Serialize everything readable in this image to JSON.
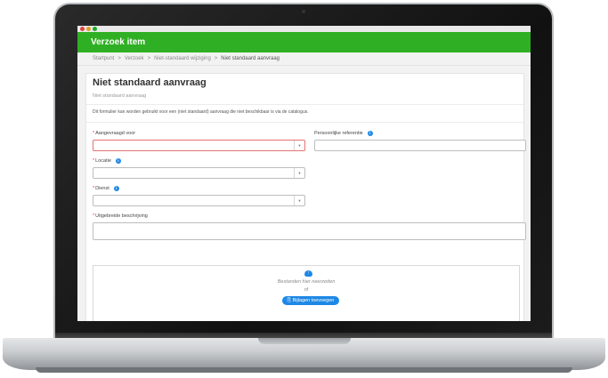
{
  "app": {
    "title": "Verzoek item"
  },
  "breadcrumb": [
    "Startpunt",
    "Verzoek",
    "Niet-standaard wijziging",
    "Niet standaard aanvraag"
  ],
  "page": {
    "title": "Niet standaard aanvraag",
    "subtitle": "Niet standaard aanvraag",
    "intro": "Dit formulier kan worden gebruikt voor een (niet standaard) aanvraag die niet beschikbaar is via de catalogus."
  },
  "form": {
    "requested_for": {
      "label": "Aangevraagd voor",
      "value": ""
    },
    "personal_reference": {
      "label": "Persoonlijke referentie",
      "value": ""
    },
    "location": {
      "label": "Locatie",
      "value": ""
    },
    "service": {
      "label": "Dienst",
      "value": ""
    },
    "description": {
      "label": "Uitgebreide beschrijving",
      "value": ""
    }
  },
  "attachments": {
    "drop_text": "Bestanden hier neerzetten",
    "or_text": "of",
    "button_label": "Bijlagen toevoegen"
  },
  "colors": {
    "header_green": "#2fb024",
    "accent_blue": "#1e88e5",
    "required_red": "#e0443e"
  }
}
